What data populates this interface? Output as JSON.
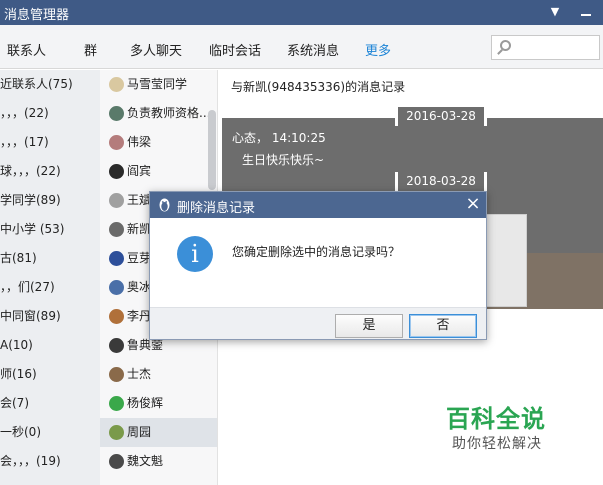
{
  "app": {
    "title": "消息管理器"
  },
  "tabs": [
    {
      "label": "联系人"
    },
    {
      "label": "群"
    },
    {
      "label": "多人聊天"
    },
    {
      "label": "临时会话"
    },
    {
      "label": "系统消息"
    },
    {
      "label": "更多"
    }
  ],
  "groups": [
    {
      "label": "近联系人(75)"
    },
    {
      "label": "，，，(22)"
    },
    {
      "label": "，，，(17)"
    },
    {
      "label": "球，，，(22)"
    },
    {
      "label": "学同学(89)"
    },
    {
      "label": "中小学 (53)"
    },
    {
      "label": "古(81)"
    },
    {
      "label": "，，们(27)"
    },
    {
      "label": "中同窗(89)"
    },
    {
      "label": "A(10)"
    },
    {
      "label": "师(16)"
    },
    {
      "label": "会(7)"
    },
    {
      "label": "一秒(0)"
    },
    {
      "label": "会，，，(19)"
    }
  ],
  "contacts": [
    {
      "name": "马雪莹同学",
      "avatar_color": "#d9c8a0"
    },
    {
      "name": "负责教师资格...",
      "avatar_color": "#5a7a6a"
    },
    {
      "name": "伟梁",
      "avatar_color": "#b47c7c"
    },
    {
      "name": "阎宾",
      "avatar_color": "#2a2a2a"
    },
    {
      "name": "王斌",
      "avatar_color": "#a0a0a0"
    },
    {
      "name": "新凯",
      "avatar_color": "#6a6a6a"
    },
    {
      "name": "豆芽",
      "avatar_color": "#2d4f9a"
    },
    {
      "name": "奥冰",
      "avatar_color": "#4a6fa8"
    },
    {
      "name": "李丹",
      "avatar_color": "#b0703a"
    },
    {
      "name": "鲁典蓥",
      "avatar_color": "#3a3a3a"
    },
    {
      "name": "士杰",
      "avatar_color": "#8a6a4a"
    },
    {
      "name": "杨俊辉",
      "avatar_color": "#3aa84a"
    },
    {
      "name": "周园",
      "avatar_color": "#7a9a4a"
    },
    {
      "name": "魏文魁",
      "avatar_color": "#4a4a4a"
    }
  ],
  "record": {
    "header": "与新凯(948435336)的消息记录",
    "dates": [
      "2016-03-28",
      "2018-03-28"
    ],
    "message_meta": "心态， 14:10:25",
    "message_text": "生日快乐快乐~"
  },
  "dialog": {
    "title": "删除消息记录",
    "info_glyph": "i",
    "message": "您确定删除选中的消息记录吗？",
    "yes_label": "是",
    "no_label": "否",
    "close_glyph": "×"
  },
  "watermark": {
    "title": "百科全说",
    "subtitle": "助你轻松解决"
  }
}
